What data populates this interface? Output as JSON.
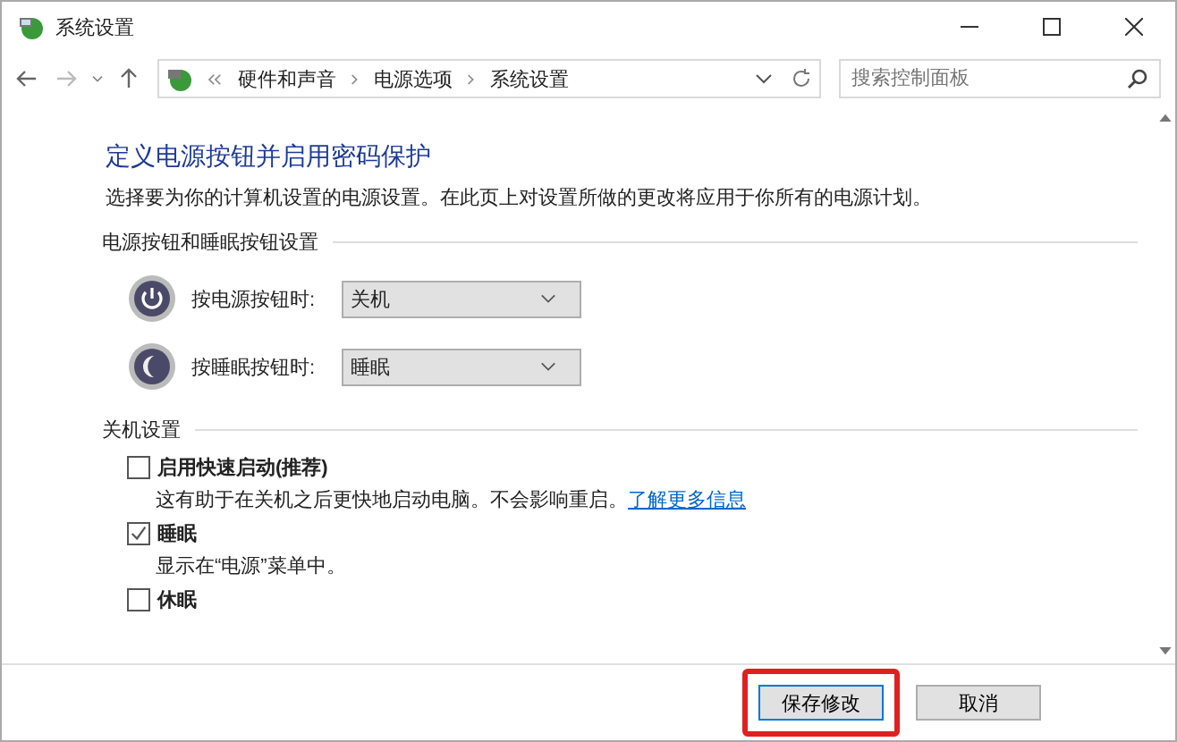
{
  "window": {
    "title": "系统设置"
  },
  "breadcrumb": [
    "硬件和声音",
    "电源选项",
    "系统设置"
  ],
  "search": {
    "placeholder": "搜索控制面板"
  },
  "heading": "定义电源按钮并启用密码保护",
  "intro": "选择要为你的计算机设置的电源设置。在此页上对设置所做的更改将应用于你所有的电源计划。",
  "button_section": {
    "title": "电源按钮和睡眠按钮设置",
    "rows": [
      {
        "kind": "power",
        "label": "按电源按钮时:",
        "value": "关机"
      },
      {
        "kind": "sleep",
        "label": "按睡眠按钮时:",
        "value": "睡眠"
      }
    ]
  },
  "shutdown_section": {
    "title": "关机设置",
    "options": [
      {
        "label": "启用快速启动(推荐)",
        "checked": false,
        "description": "这有助于在关机之后更快地启动电脑。不会影响重启。",
        "link": "了解更多信息"
      },
      {
        "label": "睡眠",
        "checked": true,
        "description": "显示在“电源”菜单中。"
      },
      {
        "label": "休眠",
        "checked": false
      }
    ]
  },
  "buttons": [
    {
      "label": "保存修改",
      "highlighted": true
    },
    {
      "label": "取消",
      "highlighted": false
    }
  ]
}
